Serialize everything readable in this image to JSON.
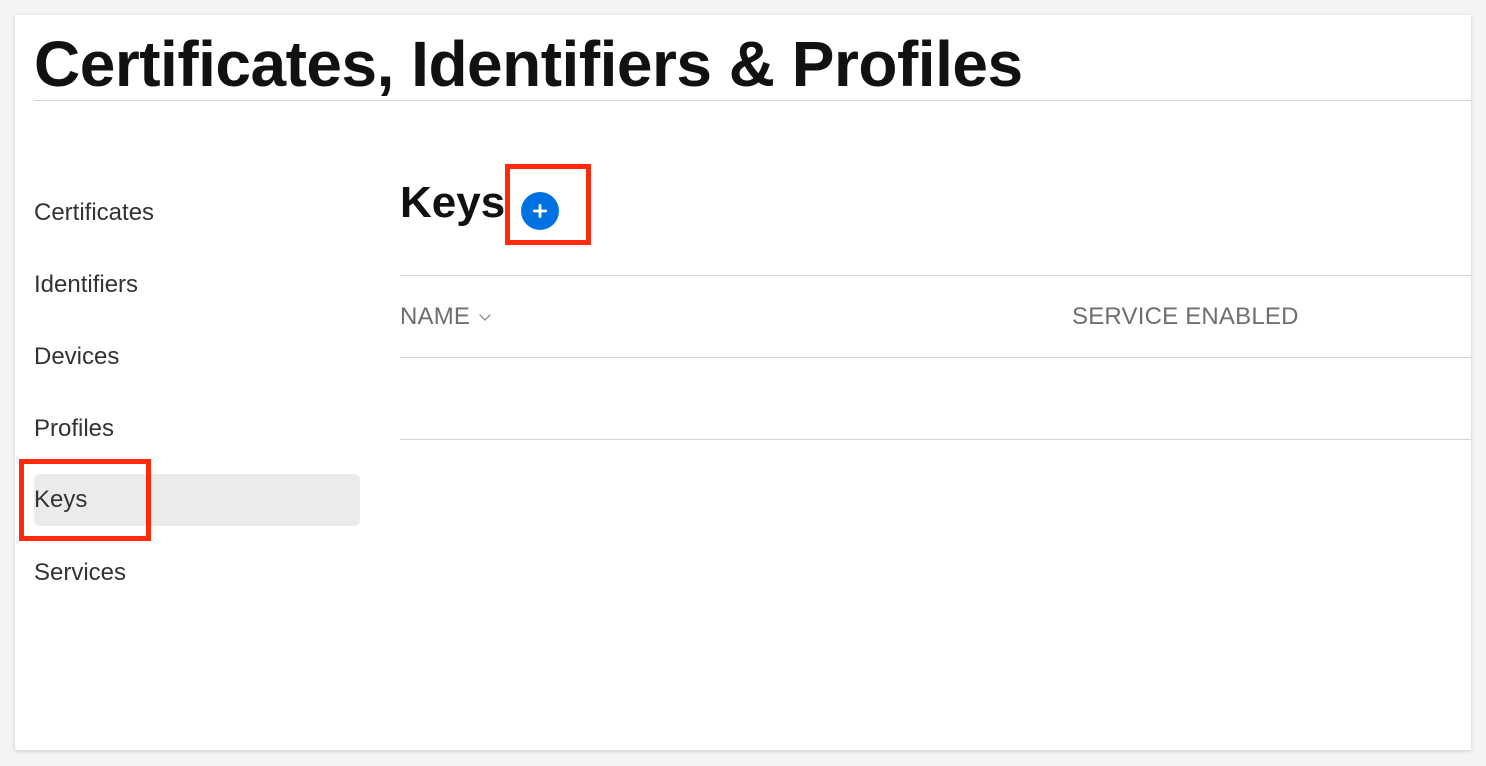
{
  "page": {
    "title": "Certificates, Identifiers & Profiles"
  },
  "sidebar": {
    "items": [
      {
        "label": "Certificates"
      },
      {
        "label": "Identifiers"
      },
      {
        "label": "Devices"
      },
      {
        "label": "Profiles"
      },
      {
        "label": "Keys",
        "active": true
      },
      {
        "label": "Services"
      }
    ]
  },
  "main": {
    "section_title": "Keys",
    "add_button_icon": "plus-circle-icon",
    "table": {
      "columns": [
        {
          "label": "NAME",
          "sortable": true,
          "sort_icon": "chevron-down-icon"
        },
        {
          "label": "SERVICE ENABLED"
        }
      ],
      "rows": []
    }
  },
  "colors": {
    "accent": "#0071e3",
    "highlight": "#ff2a0b",
    "active_item_bg": "#ebebeb"
  }
}
